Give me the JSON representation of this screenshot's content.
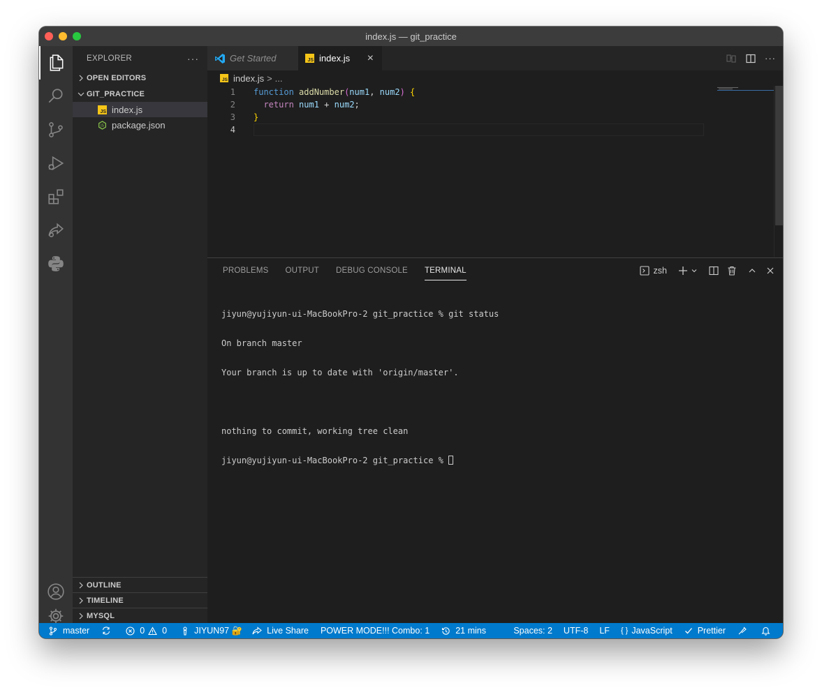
{
  "window": {
    "title": "index.js — git_practice"
  },
  "colors": {
    "accent": "#007acc",
    "js_yellow": "#f5c518",
    "node_green": "#8cc84b",
    "vscode_blue": "#23a9f2"
  },
  "activity_bar": {
    "top": [
      "explorer-icon",
      "search-icon",
      "source-control-icon",
      "run-debug-icon",
      "extensions-icon",
      "live-share-icon",
      "python-icon"
    ],
    "bottom": [
      "account-icon",
      "settings-gear-icon"
    ]
  },
  "sidebar": {
    "title": "EXPLORER",
    "more": "···",
    "sections": {
      "open_editors": "OPEN EDITORS",
      "folder": "GIT_PRACTICE",
      "outline": "OUTLINE",
      "timeline": "TIMELINE",
      "mysql": "MYSQL"
    },
    "files": [
      {
        "name": "index.js",
        "icon": "JS",
        "selected": true
      },
      {
        "name": "package.json",
        "icon": "node-icon",
        "selected": false
      }
    ]
  },
  "tabs": [
    {
      "label": "Get Started",
      "active": false
    },
    {
      "label": "index.js",
      "active": true,
      "icon": "JS",
      "close": "×"
    }
  ],
  "breadcrumb": {
    "file": "index.js",
    "separator": ">",
    "rest": "..."
  },
  "editor": {
    "lines": [
      {
        "number": "1",
        "tokens": [
          {
            "t": "function",
            "c": "#569cd6"
          },
          {
            "t": " ",
            "c": "#d4d4d4"
          },
          {
            "t": "addNumber",
            "c": "#dcdcaa"
          },
          {
            "t": "(",
            "c": "#da70d6"
          },
          {
            "t": "num1",
            "c": "#9cdcfe"
          },
          {
            "t": ", ",
            "c": "#d4d4d4"
          },
          {
            "t": "num2",
            "c": "#9cdcfe"
          },
          {
            "t": ") ",
            "c": "#da70d6"
          },
          {
            "t": "{",
            "c": "#ffd700"
          }
        ]
      },
      {
        "number": "2",
        "tokens": [
          {
            "t": "  ",
            "c": "#d4d4d4"
          },
          {
            "t": "return",
            "c": "#c586c0"
          },
          {
            "t": " ",
            "c": "#d4d4d4"
          },
          {
            "t": "num1",
            "c": "#9cdcfe"
          },
          {
            "t": " + ",
            "c": "#d4d4d4"
          },
          {
            "t": "num2",
            "c": "#9cdcfe"
          },
          {
            "t": ";",
            "c": "#d4d4d4"
          }
        ]
      },
      {
        "number": "3",
        "tokens": [
          {
            "t": "}",
            "c": "#ffd700"
          }
        ]
      },
      {
        "number": "4",
        "tokens": []
      }
    ]
  },
  "panel": {
    "tabs": [
      "PROBLEMS",
      "OUTPUT",
      "DEBUG CONSOLE",
      "TERMINAL"
    ],
    "active_tab": "TERMINAL",
    "shell": "zsh",
    "terminal_lines": [
      "jiyun@yujiyun-ui-MacBookPro-2 git_practice % git status",
      "On branch master",
      "Your branch is up to date with 'origin/master'.",
      "",
      "nothing to commit, working tree clean",
      "jiyun@yujiyun-ui-MacBookPro-2 git_practice % "
    ]
  },
  "statusbar": {
    "branch": "master",
    "errors": "0",
    "warnings": "0",
    "account": "JIYUN97 🔐",
    "live_share": "Live Share",
    "power_mode": "POWER MODE!!! Combo: 1",
    "time": "21 mins",
    "spaces": "Spaces: 2",
    "encoding": "UTF-8",
    "eol": "LF",
    "language": "JavaScript",
    "prettier": "Prettier"
  }
}
